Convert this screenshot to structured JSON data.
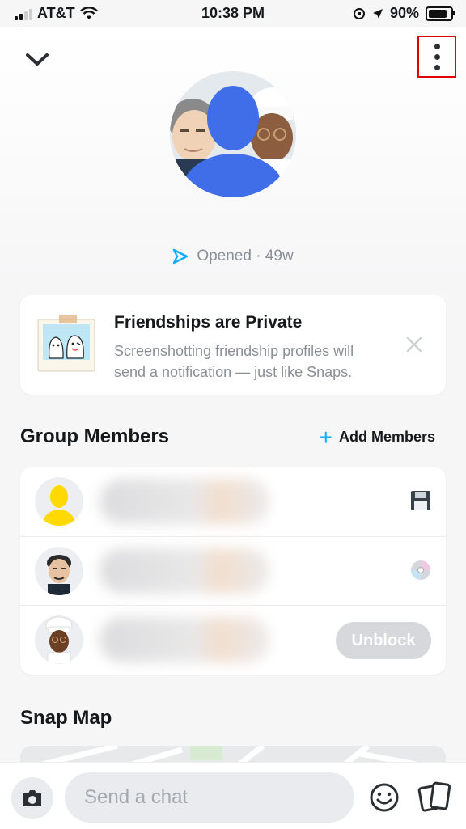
{
  "status_bar": {
    "carrier": "AT&T",
    "time": "10:38 PM",
    "battery_percent": "90%",
    "battery_level": 0.9,
    "signal_bars": 2
  },
  "header": {
    "back_icon": "chevron-down-icon",
    "more_icon": "more-vertical-icon"
  },
  "status": {
    "icon": "sent-arrow-icon",
    "text": "Opened · 49w",
    "accent": "#0fadff"
  },
  "notice": {
    "title": "Friendships are Private",
    "description": "Screenshotting friendship profiles will send a notification — just like Snaps."
  },
  "group_members": {
    "title": "Group Members",
    "add_label": "Add Members",
    "members": [
      {
        "avatar": "yellow-silhouette-avatar",
        "status_icon": "floppy-disk-icon"
      },
      {
        "avatar": "bitmoji-avatar",
        "status_icon": "cd-icon"
      },
      {
        "avatar": "chef-bitmoji-avatar",
        "action_label": "Unblock"
      }
    ]
  },
  "snap_map": {
    "title": "Snap Map"
  },
  "chat_bar": {
    "placeholder": "Send a chat",
    "camera_icon": "camera-icon",
    "emoji_icon": "smiley-icon",
    "cards_icon": "cards-icon"
  }
}
